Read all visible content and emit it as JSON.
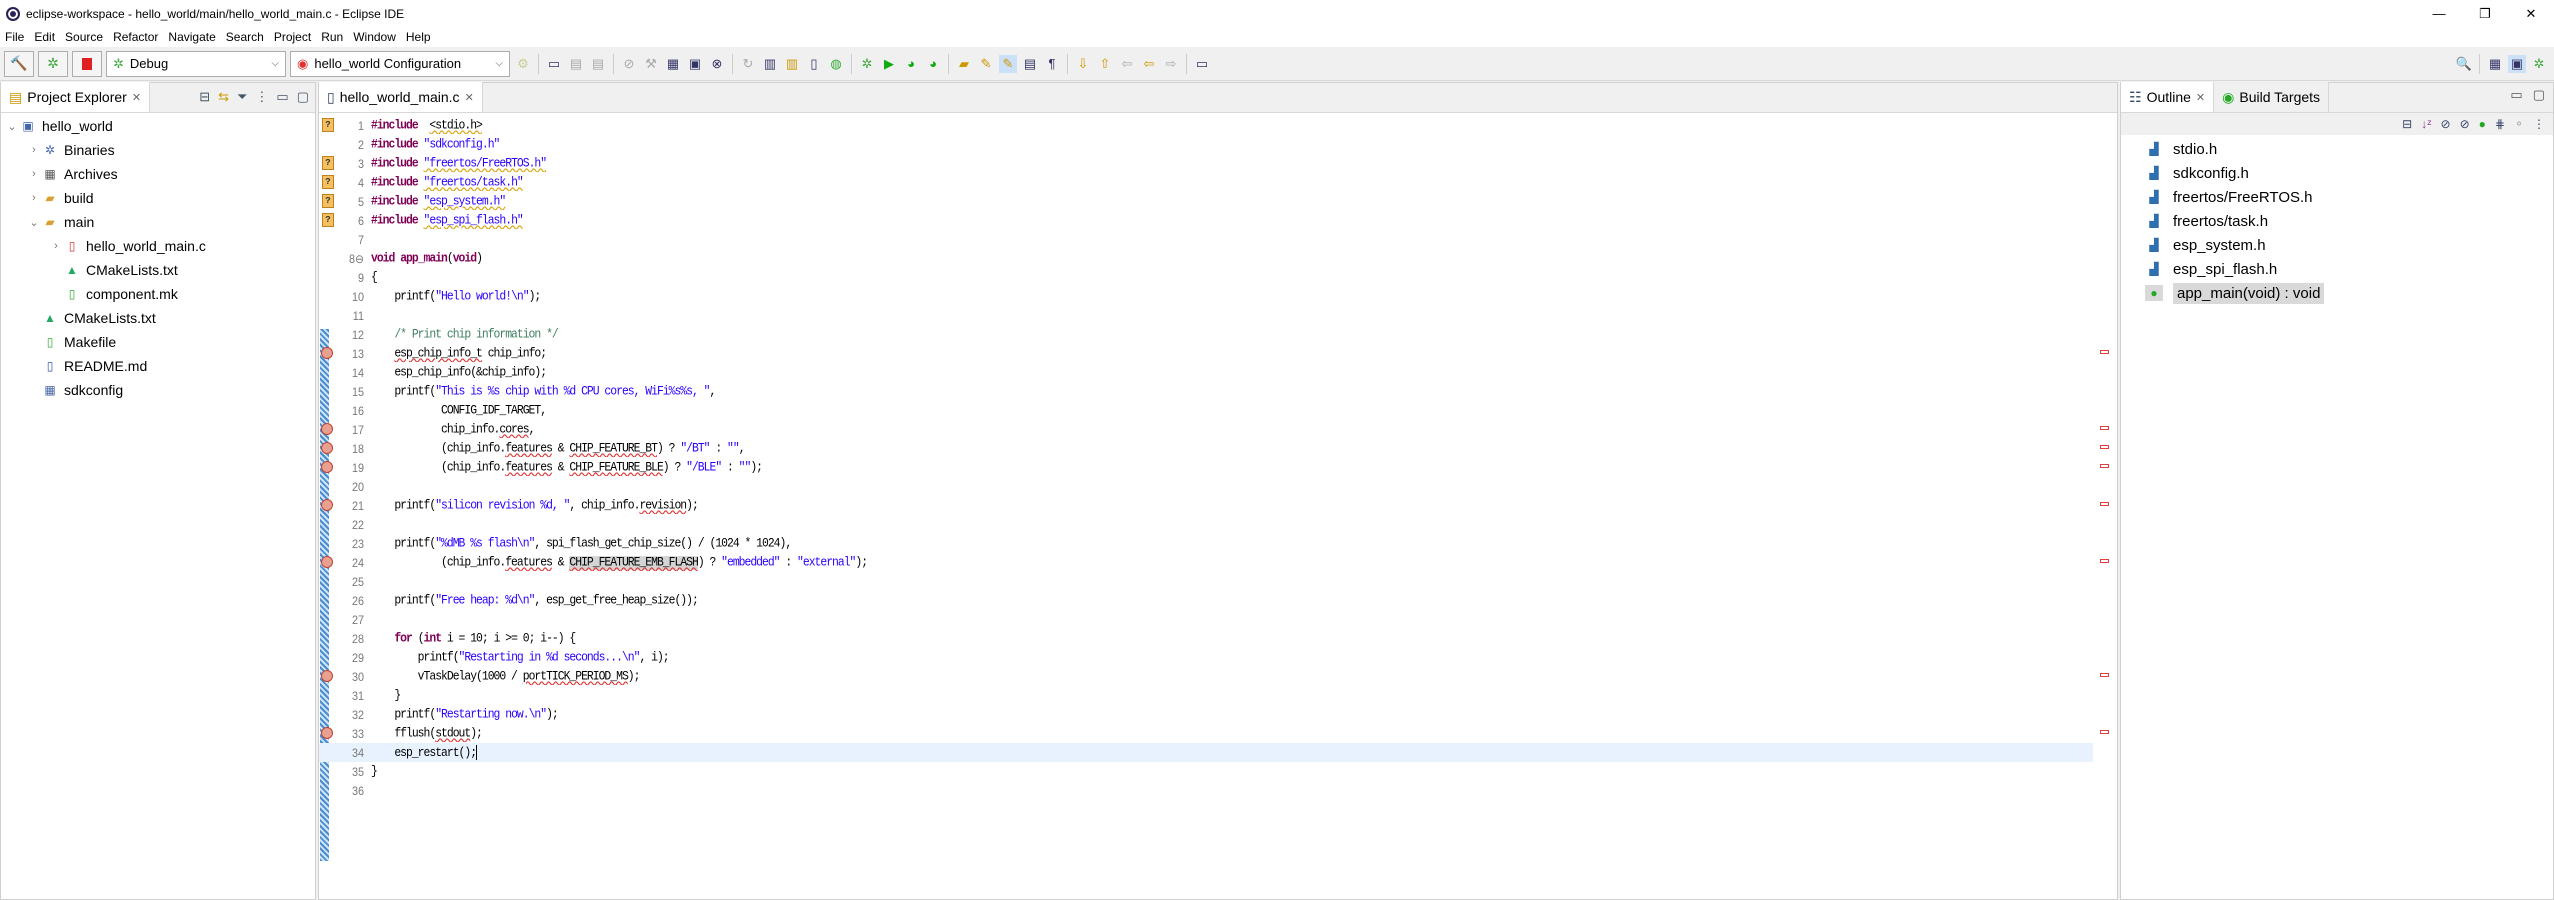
{
  "window": {
    "title": "eclipse-workspace - hello_world/main/hello_world_main.c - Eclipse IDE"
  },
  "menu": [
    "File",
    "Edit",
    "Source",
    "Refactor",
    "Navigate",
    "Search",
    "Project",
    "Run",
    "Window",
    "Help"
  ],
  "toolbar": {
    "launch_mode": "Debug",
    "launch_config": "hello_world Configuration"
  },
  "project_explorer": {
    "tab": "Project Explorer",
    "items": [
      {
        "label": "hello_world",
        "depth": 0,
        "tw": "v",
        "icon": "project-icon"
      },
      {
        "label": "Binaries",
        "depth": 1,
        "tw": ">",
        "icon": "binaries-icon"
      },
      {
        "label": "Archives",
        "depth": 1,
        "tw": ">",
        "icon": "archives-icon"
      },
      {
        "label": "build",
        "depth": 1,
        "tw": ">",
        "icon": "folder-icon"
      },
      {
        "label": "main",
        "depth": 1,
        "tw": "v",
        "icon": "folder-error-icon"
      },
      {
        "label": "hello_world_main.c",
        "depth": 2,
        "tw": ">",
        "icon": "c-file-error-icon"
      },
      {
        "label": "CMakeLists.txt",
        "depth": 2,
        "tw": "",
        "icon": "cmake-icon"
      },
      {
        "label": "component.mk",
        "depth": 2,
        "tw": "",
        "icon": "make-file-icon"
      },
      {
        "label": "CMakeLists.txt",
        "depth": 1,
        "tw": "",
        "icon": "cmake-icon"
      },
      {
        "label": "Makefile",
        "depth": 1,
        "tw": "",
        "icon": "make-file-icon"
      },
      {
        "label": "README.md",
        "depth": 1,
        "tw": "",
        "icon": "text-file-icon"
      },
      {
        "label": "sdkconfig",
        "depth": 1,
        "tw": "",
        "icon": "config-file-icon"
      }
    ]
  },
  "editor": {
    "tab": "hello_world_main.c",
    "current_line": 34,
    "lines": [
      {
        "n": "1",
        "m": "warn",
        "t": [
          [
            "kw",
            "#include"
          ],
          [
            "",
            "  "
          ],
          [
            "inc",
            "<stdio.h>"
          ]
        ]
      },
      {
        "n": "2",
        "t": [
          [
            "kw",
            "#include"
          ],
          [
            "",
            " "
          ],
          [
            "str",
            "\"sdkconfig.h\""
          ]
        ]
      },
      {
        "n": "3",
        "m": "warn",
        "t": [
          [
            "kw",
            "#include"
          ],
          [
            "",
            " "
          ],
          [
            "inc str",
            "\"freertos/FreeRTOS.h\""
          ]
        ]
      },
      {
        "n": "4",
        "m": "warn",
        "t": [
          [
            "kw",
            "#include"
          ],
          [
            "",
            " "
          ],
          [
            "inc str",
            "\"freertos/task.h\""
          ]
        ]
      },
      {
        "n": "5",
        "m": "warn",
        "t": [
          [
            "kw",
            "#include"
          ],
          [
            "",
            " "
          ],
          [
            "inc str",
            "\"esp_system.h\""
          ]
        ]
      },
      {
        "n": "6",
        "m": "warn",
        "t": [
          [
            "kw",
            "#include"
          ],
          [
            "",
            " "
          ],
          [
            "inc str",
            "\"esp_spi_flash.h\""
          ]
        ]
      },
      {
        "n": "7",
        "t": []
      },
      {
        "n": "8⊖",
        "t": [
          [
            "kw",
            "void"
          ],
          [
            "",
            " "
          ],
          [
            "kw",
            "app_main"
          ],
          [
            "",
            "("
          ],
          [
            "kw",
            "void"
          ],
          [
            "",
            ")"
          ]
        ]
      },
      {
        "n": "9",
        "t": [
          [
            "",
            "{"
          ]
        ]
      },
      {
        "n": "10",
        "t": [
          [
            "",
            "    printf("
          ],
          [
            "str",
            "\"Hello world!\\n\""
          ],
          [
            "",
            ");"
          ]
        ]
      },
      {
        "n": "11",
        "t": []
      },
      {
        "n": "12",
        "t": [
          [
            "cm",
            "    /* Print chip information */"
          ]
        ]
      },
      {
        "n": "13",
        "m": "err",
        "t": [
          [
            "",
            "    "
          ],
          [
            "err",
            "esp_chip_info_t"
          ],
          [
            "",
            " chip_info;"
          ]
        ]
      },
      {
        "n": "14",
        "t": [
          [
            "",
            "    esp_chip_info(&chip_info);"
          ]
        ]
      },
      {
        "n": "15",
        "t": [
          [
            "",
            "    printf("
          ],
          [
            "str",
            "\"This is %s chip with %d CPU cores, WiFi%s%s, \""
          ],
          [
            "",
            ","
          ]
        ]
      },
      {
        "n": "16",
        "t": [
          [
            "",
            "            CONFIG_IDF_TARGET,"
          ]
        ]
      },
      {
        "n": "17",
        "m": "err",
        "t": [
          [
            "",
            "            chip_info."
          ],
          [
            "err",
            "cores"
          ],
          [
            "",
            ","
          ]
        ]
      },
      {
        "n": "18",
        "m": "err",
        "t": [
          [
            "",
            "            (chip_info."
          ],
          [
            "err",
            "features"
          ],
          [
            "",
            " & "
          ],
          [
            "err",
            "CHIP_FEATURE_BT"
          ],
          [
            "",
            ") ? "
          ],
          [
            "str",
            "\"/BT\""
          ],
          [
            "",
            " : "
          ],
          [
            "str",
            "\"\""
          ],
          [
            "",
            ","
          ]
        ]
      },
      {
        "n": "19",
        "m": "err",
        "t": [
          [
            "",
            "            (chip_info."
          ],
          [
            "err",
            "features"
          ],
          [
            "",
            " & "
          ],
          [
            "err",
            "CHIP_FEATURE_BLE"
          ],
          [
            "",
            ") ? "
          ],
          [
            "str",
            "\"/BLE\""
          ],
          [
            "",
            " : "
          ],
          [
            "str",
            "\"\""
          ],
          [
            "",
            ");"
          ]
        ]
      },
      {
        "n": "20",
        "t": []
      },
      {
        "n": "21",
        "m": "err",
        "t": [
          [
            "",
            "    printf("
          ],
          [
            "str",
            "\"silicon revision %d, \""
          ],
          [
            "",
            ", chip_info."
          ],
          [
            "err",
            "revision"
          ],
          [
            "",
            ");"
          ]
        ]
      },
      {
        "n": "22",
        "t": []
      },
      {
        "n": "23",
        "t": [
          [
            "",
            "    printf("
          ],
          [
            "str",
            "\"%dMB %s flash\\n\""
          ],
          [
            "",
            ", spi_flash_get_chip_size() / (1024 * 1024),"
          ]
        ]
      },
      {
        "n": "24",
        "m": "err",
        "t": [
          [
            "",
            "            (chip_info."
          ],
          [
            "err",
            "features"
          ],
          [
            "",
            " & "
          ],
          [
            "err hl",
            "CHIP_FEATURE_EMB_FLASH"
          ],
          [
            "",
            ") ? "
          ],
          [
            "str",
            "\"embedded\""
          ],
          [
            "",
            " : "
          ],
          [
            "str",
            "\"external\""
          ],
          [
            "",
            ");"
          ]
        ]
      },
      {
        "n": "25",
        "t": []
      },
      {
        "n": "26",
        "t": [
          [
            "",
            "    printf("
          ],
          [
            "str",
            "\"Free heap: %d\\n\""
          ],
          [
            "",
            ", esp_get_free_heap_size());"
          ]
        ]
      },
      {
        "n": "27",
        "t": []
      },
      {
        "n": "28",
        "t": [
          [
            "",
            "    "
          ],
          [
            "kw",
            "for"
          ],
          [
            "",
            " ("
          ],
          [
            "kw",
            "int"
          ],
          [
            "",
            " i = 10; i >= 0; i--) {"
          ]
        ]
      },
      {
        "n": "29",
        "t": [
          [
            "",
            "        printf("
          ],
          [
            "str",
            "\"Restarting in %d seconds...\\n\""
          ],
          [
            "",
            ", i);"
          ]
        ]
      },
      {
        "n": "30",
        "m": "err",
        "t": [
          [
            "",
            "        vTaskDelay(1000 / "
          ],
          [
            "err",
            "portTICK_PERIOD_MS"
          ],
          [
            "",
            ");"
          ]
        ]
      },
      {
        "n": "31",
        "t": [
          [
            "",
            "    }"
          ]
        ]
      },
      {
        "n": "32",
        "t": [
          [
            "",
            "    printf("
          ],
          [
            "str",
            "\"Restarting now.\\n\""
          ],
          [
            "",
            ");"
          ]
        ]
      },
      {
        "n": "33",
        "m": "err",
        "t": [
          [
            "",
            "    fflush("
          ],
          [
            "err",
            "stdout"
          ],
          [
            "",
            ");"
          ]
        ]
      },
      {
        "n": "34",
        "t": [
          [
            "",
            "    esp_restart();"
          ]
        ]
      },
      {
        "n": "35",
        "t": [
          [
            "",
            "}"
          ]
        ]
      },
      {
        "n": "36",
        "t": []
      }
    ]
  },
  "outline": {
    "tabs": [
      "Outline",
      "Build Targets"
    ],
    "items": [
      {
        "label": "stdio.h",
        "icon": "include-warning-icon"
      },
      {
        "label": "sdkconfig.h",
        "icon": "include-icon"
      },
      {
        "label": "freertos/FreeRTOS.h",
        "icon": "include-warning-icon"
      },
      {
        "label": "freertos/task.h",
        "icon": "include-warning-icon"
      },
      {
        "label": "esp_system.h",
        "icon": "include-warning-icon"
      },
      {
        "label": "esp_spi_flash.h",
        "icon": "include-warning-icon"
      },
      {
        "label": "app_main(void) : void",
        "icon": "function-error-icon",
        "selected": true
      }
    ]
  }
}
